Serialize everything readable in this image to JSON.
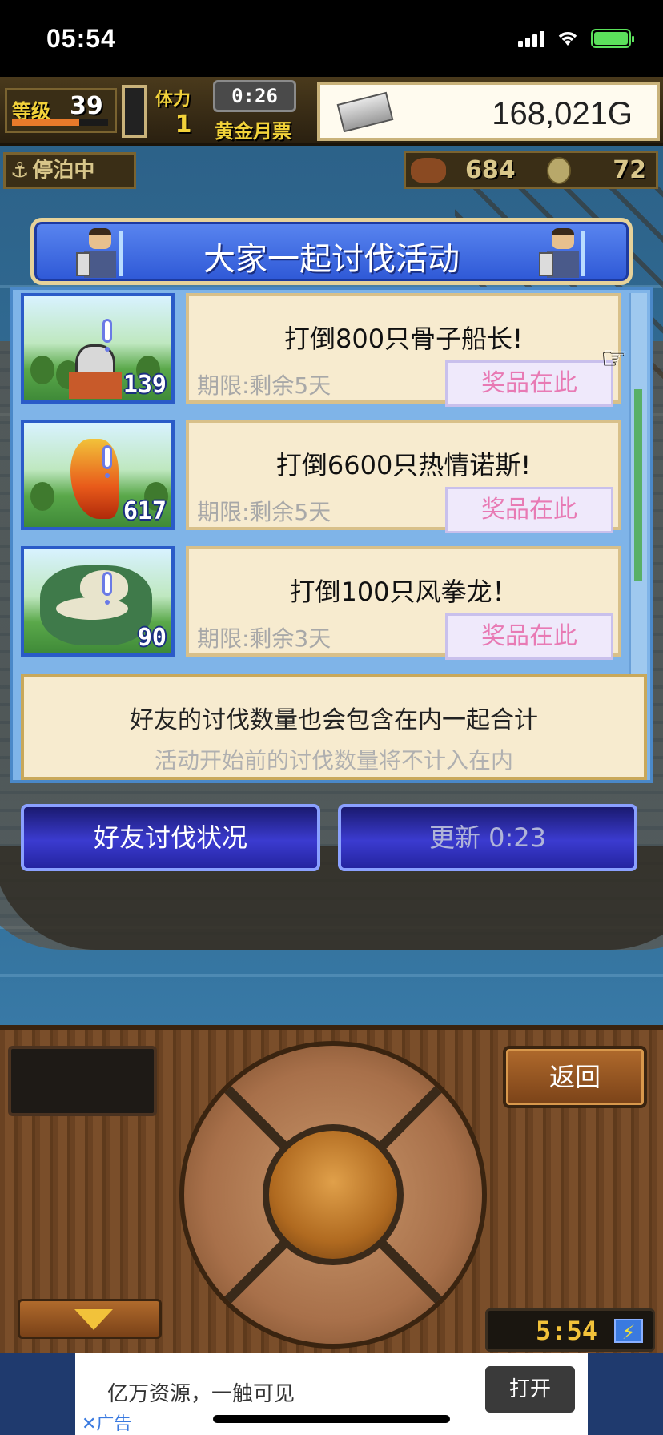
{
  "status_bar": {
    "time": "05:54"
  },
  "hud": {
    "level_label": "等级",
    "level_value": "39",
    "level_progress": 0.7,
    "stamina_label": "体力",
    "stamina_value": "1",
    "timer": "0:26",
    "ticket_label": "黄金月票",
    "gold": "168,021G",
    "mooring_status": "停泊中",
    "resource_1": "684",
    "resource_2": "72"
  },
  "event_panel": {
    "title": "大家一起讨伐活动",
    "events": [
      {
        "title": "打倒800只骨子船长!",
        "deadline": "期限:剩余5天",
        "reward_label": "奖品在此",
        "count": "139",
        "monster_icon": "skeleton-captain-icon"
      },
      {
        "title": "打倒6600只热情诺斯!",
        "deadline": "期限:剩余5天",
        "reward_label": "奖品在此",
        "count": "617",
        "monster_icon": "flame-monster-icon"
      },
      {
        "title": "打倒100只风拳龙！",
        "deadline": "期限:剩余3天",
        "reward_label": "奖品在此",
        "count": "90",
        "monster_icon": "dragon-icon"
      }
    ],
    "note_main": "好友的讨伐数量也会包含在内一起合计",
    "note_sub": "活动开始前的讨伐数量将不计入在内"
  },
  "buttons": {
    "friend_status": "好友讨伐状况",
    "refresh": "更新 0:23"
  },
  "console": {
    "return_label": "返回",
    "clock": "5:54",
    "bolt_icon": "⚡"
  },
  "ad": {
    "text": "亿万资源，一触可见",
    "open_label": "打开",
    "ad_label": "✕广告"
  }
}
